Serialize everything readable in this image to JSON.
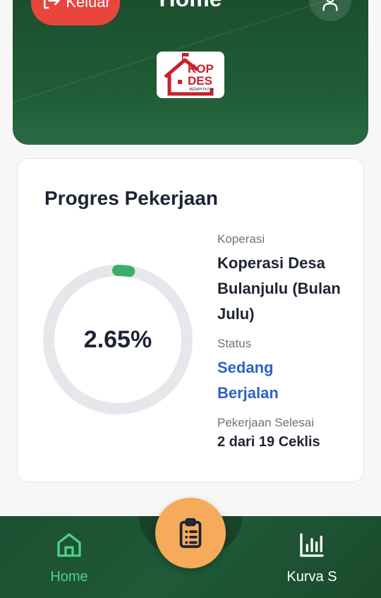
{
  "header": {
    "title": "Home",
    "logout_label": "Keluar",
    "logo_text_top": "KOP",
    "logo_text_bottom": "DES",
    "logo_subtext": "MERAH PUTIH"
  },
  "progress_card": {
    "title": "Progres Pekerjaan",
    "percent_label": "2.65%",
    "percent_value": 2.65,
    "koperasi_label": "Koperasi",
    "koperasi_value": "Koperasi Desa Bulanjulu (Bulan Julu)",
    "status_label": "Status",
    "status_value": "Sedang Berjalan",
    "selesai_label": "Pekerjaan Selesai",
    "selesai_value": "2 dari 19 Ceklis"
  },
  "nav": {
    "home_label": "Home",
    "kurva_label": "Kurva S"
  },
  "colors": {
    "header_green": "#1f5d36",
    "logout_red": "#e8453c",
    "progress_green": "#3fae6b",
    "status_blue": "#2d63c3",
    "active_nav": "#4fd08a",
    "fab_orange": "#f6ab5a"
  },
  "icons": {
    "logout": "logout-icon",
    "profile": "user-icon",
    "home": "home-icon",
    "kurva": "bar-chart-icon",
    "fab": "clipboard-list-icon"
  }
}
